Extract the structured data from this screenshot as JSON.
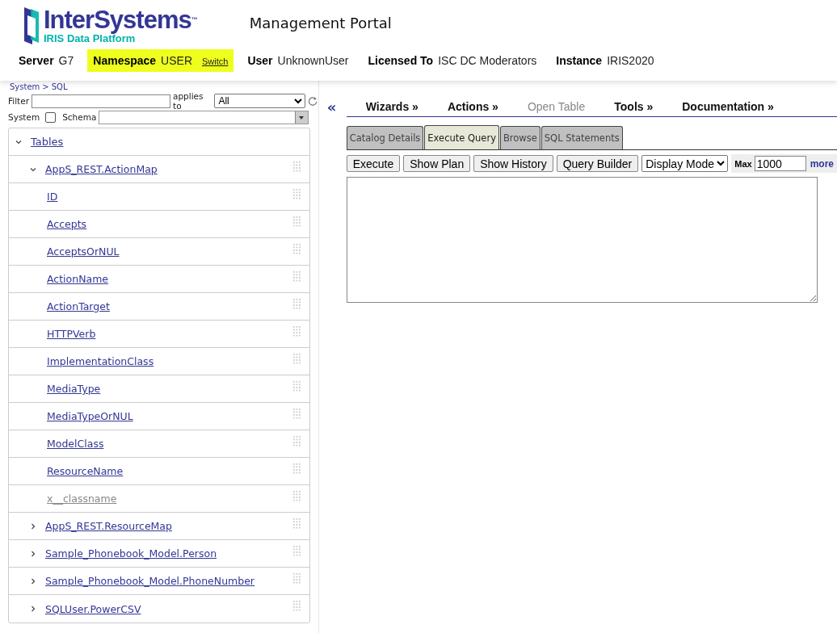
{
  "header": {
    "logo": {
      "name": "InterSystems",
      "trademark": "™",
      "tagline": "IRIS Data Platform"
    },
    "title": "Management Portal",
    "info": [
      {
        "label": "Server",
        "value": "G7",
        "highlighted": false
      },
      {
        "label": "Namespace",
        "value": "USER",
        "highlighted": true,
        "link": "Switch"
      },
      {
        "label": "User",
        "value": "UnknownUser",
        "highlighted": false
      },
      {
        "label": "Licensed To",
        "value": "ISC DC Moderators",
        "highlighted": false
      },
      {
        "label": "Instance",
        "value": "IRIS2020",
        "highlighted": false
      }
    ]
  },
  "breadcrumb": [
    "System",
    ">",
    "SQL"
  ],
  "filter": {
    "label": "Filter",
    "applies_label": "applies to",
    "applies_value": "All",
    "system_label": "System",
    "system_checked": false,
    "schema_label": "Schema"
  },
  "tree": [
    {
      "label": "Tables",
      "expanded": true,
      "children": [
        {
          "label": "AppS_REST.ActionMap",
          "expanded": true,
          "children": [
            {
              "label": "ID",
              "disabled": false
            },
            {
              "label": "Accepts",
              "disabled": false
            },
            {
              "label": "AcceptsOrNUL",
              "disabled": false
            },
            {
              "label": "ActionName",
              "disabled": false
            },
            {
              "label": "ActionTarget",
              "disabled": false
            },
            {
              "label": "HTTPVerb",
              "disabled": false
            },
            {
              "label": "ImplementationClass",
              "disabled": false
            },
            {
              "label": "MediaType",
              "disabled": false
            },
            {
              "label": "MediaTypeOrNUL",
              "disabled": false
            },
            {
              "label": "ModelClass",
              "disabled": false
            },
            {
              "label": "ResourceName",
              "disabled": false
            },
            {
              "label": "x__classname",
              "disabled": true
            }
          ]
        },
        {
          "label": "AppS_REST.ResourceMap",
          "expanded": false
        },
        {
          "label": "Sample_Phonebook_Model.Person",
          "expanded": false
        },
        {
          "label": "Sample_Phonebook_Model.PhoneNumber",
          "expanded": false
        },
        {
          "label": "SQLUser.PowerCSV",
          "expanded": false
        }
      ]
    }
  ],
  "collapse_symbol": "«",
  "menu": [
    {
      "label": "Wizards »",
      "disabled": false
    },
    {
      "label": "Actions »",
      "disabled": false
    },
    {
      "label": "Open Table",
      "disabled": true
    },
    {
      "label": "Tools »",
      "disabled": false
    },
    {
      "label": "Documentation »",
      "disabled": false
    }
  ],
  "tabs": [
    {
      "label": "Catalog Details",
      "selected": false
    },
    {
      "label": "Execute Query",
      "selected": true
    },
    {
      "label": "Browse",
      "selected": false
    },
    {
      "label": "SQL Statements",
      "selected": false
    }
  ],
  "toolbar": {
    "buttons": [
      "Execute",
      "Show Plan",
      "Show History",
      "Query Builder"
    ],
    "display_mode": "Display Mode",
    "max_label": "Max",
    "max_value": "1000",
    "more": "more"
  }
}
